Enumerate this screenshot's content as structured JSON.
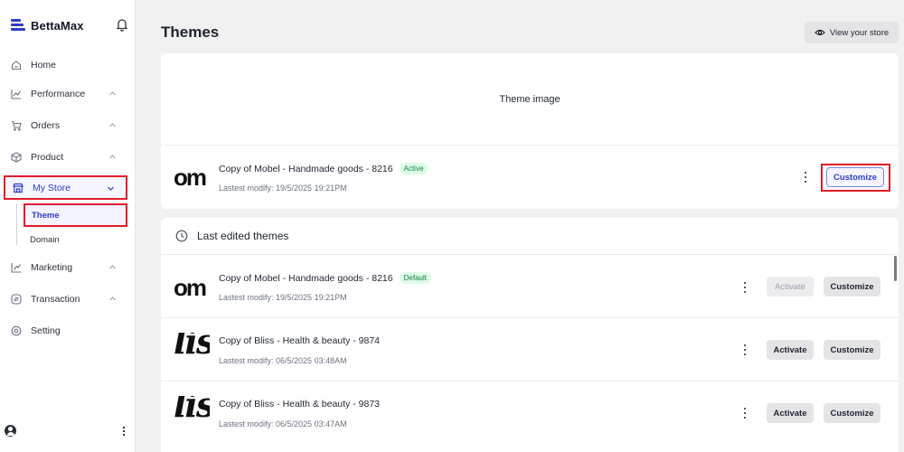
{
  "brand": {
    "name": "BettaMax"
  },
  "sidebar": {
    "items": [
      {
        "label": "Home",
        "icon": "home-icon",
        "has_chevron": false
      },
      {
        "label": "Performance",
        "icon": "chart-icon",
        "has_chevron": true
      },
      {
        "label": "Orders",
        "icon": "cart-icon",
        "has_chevron": true
      },
      {
        "label": "Product",
        "icon": "box-icon",
        "has_chevron": true
      },
      {
        "label": "My Store",
        "icon": "store-icon",
        "has_chevron": true,
        "active": true
      },
      {
        "label": "Marketing",
        "icon": "megaphone-icon",
        "has_chevron": true
      },
      {
        "label": "Transaction",
        "icon": "transaction-icon",
        "has_chevron": true
      },
      {
        "label": "Setting",
        "icon": "gear-icon",
        "has_chevron": false
      }
    ],
    "sub_items": [
      {
        "label": "Theme",
        "active": true
      },
      {
        "label": "Domain",
        "active": false
      }
    ]
  },
  "header": {
    "title": "Themes",
    "view_store_label": "View your store"
  },
  "current_theme": {
    "image_placeholder": "Theme image",
    "thumb_text": "om",
    "name": "Copy of Mobel - Handmade goods - 8216",
    "badge": "Active",
    "modified": "Lastest modify: 19/5/2025 19:21PM",
    "customize_label": "Customize"
  },
  "last_edited": {
    "title": "Last edited themes",
    "rows": [
      {
        "thumb_text": "om",
        "name": "Copy of Mobel - Handmade goods - 8216",
        "badge": "Default",
        "modified": "Lastest modify: 19/5/2025 19:21PM",
        "activate_label": "Activate",
        "activate_disabled": true,
        "customize_label": "Customize"
      },
      {
        "thumb_text": "lis",
        "name": "Copy of Bliss - Health & beauty - 9874",
        "badge": "",
        "modified": "Lastest modify: 06/5/2025 03:48AM",
        "activate_label": "Activate",
        "activate_disabled": false,
        "customize_label": "Customize"
      },
      {
        "thumb_text": "lis",
        "name": "Copy of Bliss - Health & beauty - 9873",
        "badge": "",
        "modified": "Lastest modify: 06/5/2025 03:47AM",
        "activate_label": "Activate",
        "activate_disabled": false,
        "customize_label": "Customize"
      }
    ]
  },
  "colors": {
    "accent": "#2f3cc9",
    "highlight": "#e11d2a",
    "badge_bg": "#dcfce7",
    "badge_text": "#15803d"
  }
}
